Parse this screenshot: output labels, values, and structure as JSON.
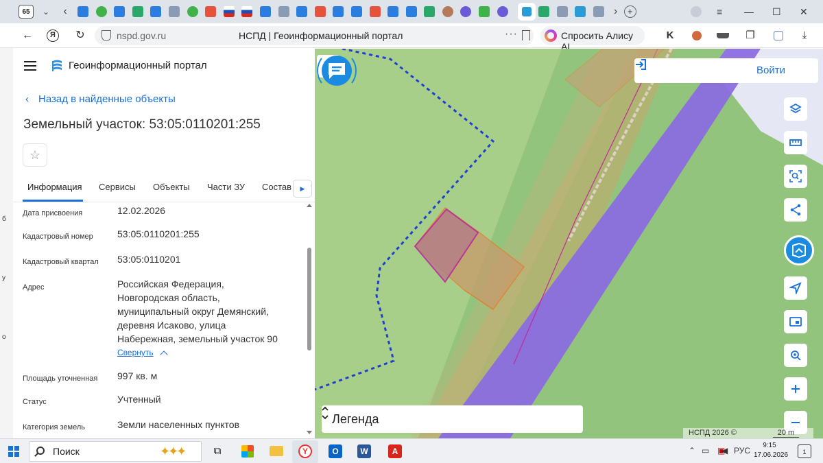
{
  "browser": {
    "tab_count": "65",
    "url_domain": "nspd.gov.ru",
    "page_title": "НСПД | Геоинформационный портал",
    "alice_label": "Спросить Алису AI"
  },
  "panel": {
    "portal_title": "Геоинформационный портал",
    "back_link": "Назад в найденные объекты",
    "object_title": "Земельный участок: 53:05:0110201:255",
    "tabs": [
      "Информация",
      "Сервисы",
      "Объекты",
      "Части ЗУ",
      "Состав"
    ],
    "rows": [
      {
        "label": "Дата присвоения",
        "value": "12.02.2026"
      },
      {
        "label": "Кадастровый номер",
        "value": "53:05:0110201:255"
      },
      {
        "label": "Кадастровый квартал",
        "value": "53:05:0110201"
      },
      {
        "label": "Адрес",
        "value_lines": [
          "Российская Федерация,",
          "Новгородская область,",
          "муниципальный округ Демянский,",
          "деревня Исаково, улица",
          "Набережная, земельный участок 90"
        ]
      },
      {
        "label": "Площадь уточненная",
        "value": "997 кв. м"
      },
      {
        "label": "Статус",
        "value": "Учтенный"
      },
      {
        "label": "Категория земель",
        "value": "Земли населенных пунктов"
      }
    ],
    "collapse_label": "Свернуть"
  },
  "map": {
    "login_label": "Войти",
    "legend_label": "Легенда",
    "credit": "НСПД 2026 ©",
    "scale": "20 m"
  },
  "taskbar": {
    "search_label": "Поиск",
    "language": "РУС",
    "time": "9:15",
    "date": "17.06.2026",
    "notification_count": "1"
  },
  "left_edge_glyphs": [
    "б",
    "у",
    "о"
  ]
}
